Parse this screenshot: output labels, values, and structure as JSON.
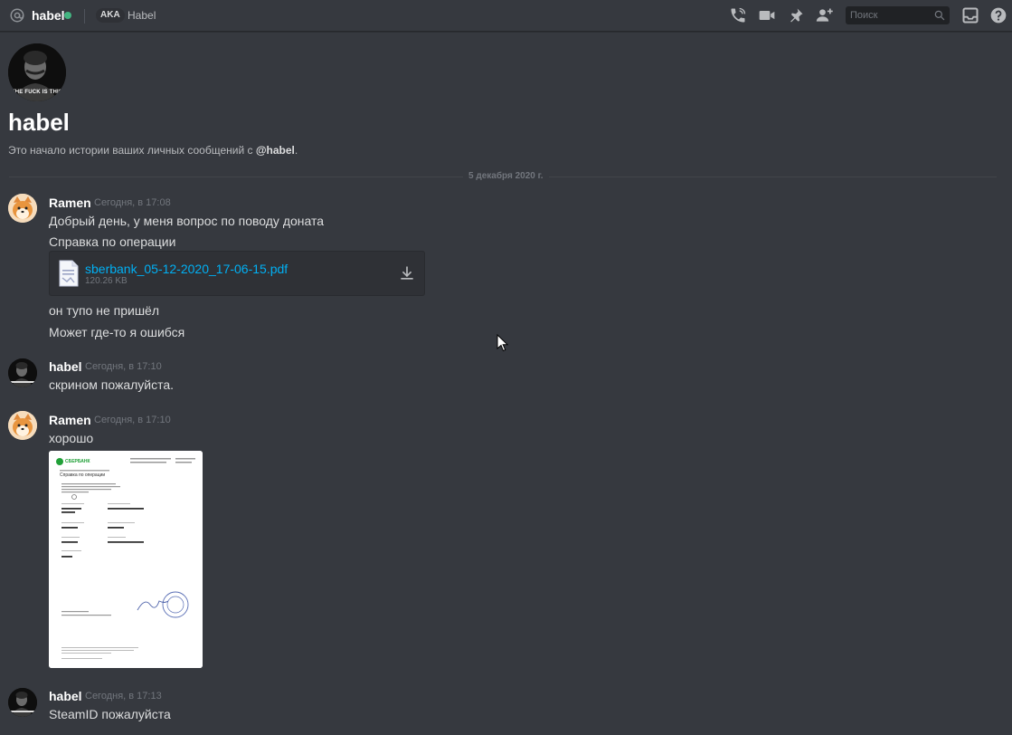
{
  "header": {
    "username": "habel",
    "aka_label": "AKA",
    "aka_name": "Habel",
    "search_placeholder": "Поиск",
    "status_color": "#43b581",
    "icons": [
      "at-icon",
      "phone-icon",
      "video-icon",
      "pin-icon",
      "add-friend-icon",
      "search-icon",
      "inbox-icon",
      "help-icon"
    ]
  },
  "intro": {
    "title": "habel",
    "text_prefix": "Это начало истории ваших личных сообщений с ",
    "mention": "@habel",
    "text_suffix": ".",
    "avatar_caption": "THE FUCK IS THIS"
  },
  "date_separator": "5 декабря 2020 г.",
  "messages": [
    {
      "author": "Ramen",
      "timestamp": "Сегодня, в 17:08",
      "lines": [
        "Добрый день, у меня вопрос по поводу доната",
        "Справка по операции"
      ],
      "attachment": {
        "filename": "sberbank_05-12-2020_17-06-15.pdf",
        "size": "120.26 KB"
      },
      "after_lines": [
        "он тупо не пришёл",
        "Может где-то я ошибся"
      ]
    },
    {
      "author": "habel",
      "timestamp": "Сегодня, в 17:10",
      "lines": [
        "скрином пожалуйста."
      ]
    },
    {
      "author": "Ramen",
      "timestamp": "Сегодня, в 17:10",
      "lines": [
        "хорошо"
      ],
      "image": {
        "brand": "СБЕРБАНК",
        "doc_title": "Справка по операции"
      }
    },
    {
      "author": "habel",
      "timestamp": "Сегодня, в 17:13",
      "lines": [
        "SteamID пожалуйста"
      ]
    }
  ],
  "colors": {
    "background": "#36393f",
    "link": "#00b0f4",
    "online": "#43b581"
  }
}
